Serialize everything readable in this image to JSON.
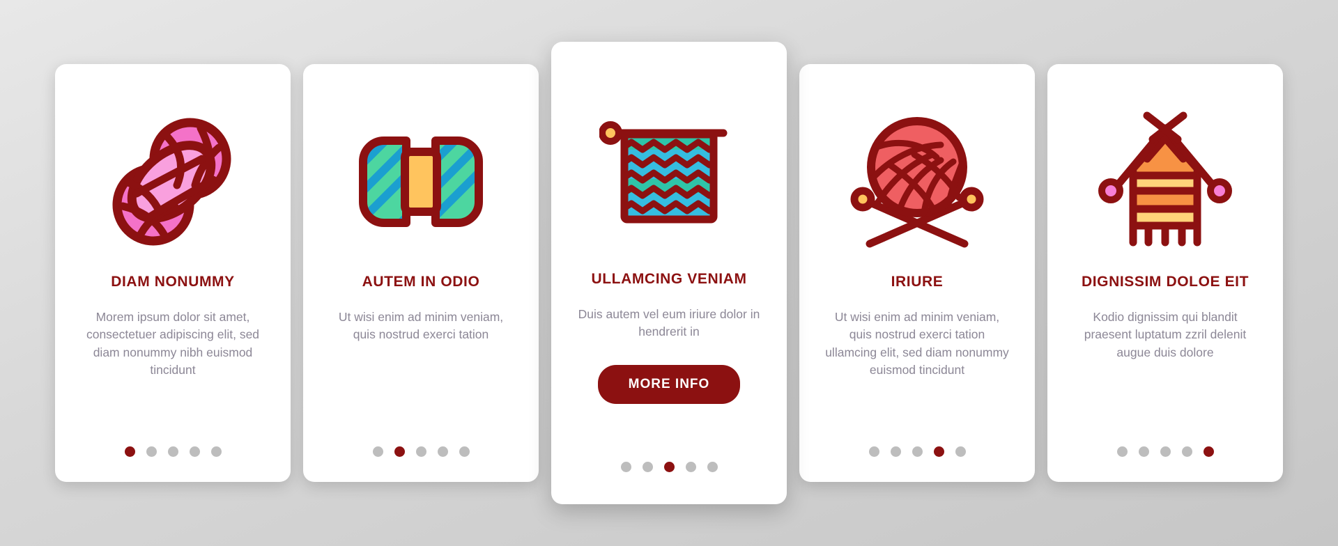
{
  "accent_color": "#8c1111",
  "dot_inactive_color": "#bdbdbd",
  "body_text_color": "#8c8796",
  "card_background": "#ffffff",
  "page_background": "#d4d4d4",
  "cards": [
    {
      "icon": "yarn-skeins-icon",
      "title": "DIAM NONUMMY",
      "body": "Morem ipsum dolor sit amet, consectetuer adipiscing elit, sed diam nonummy nibh euismod tincidunt",
      "featured": false,
      "dots_total": 5,
      "active_dot": 1
    },
    {
      "icon": "knitted-bow-tie-icon",
      "title": "AUTEM IN ODIO",
      "body": "Ut wisi enim ad minim veniam, quis nostrud exerci tation",
      "featured": false,
      "dots_total": 5,
      "active_dot": 2
    },
    {
      "icon": "knitted-towel-on-rod-icon",
      "title": "ULLAMCING VENIAM",
      "body": "Duis autem vel eum iriure dolor in hendrerit in",
      "button_label": "MORE INFO",
      "featured": true,
      "dots_total": 5,
      "active_dot": 3
    },
    {
      "icon": "yarn-ball-with-needles-icon",
      "title": "IRIURE",
      "body": "Ut wisi enim ad minim veniam, quis nostrud exerci tation ullamcing elit, sed diam nonummy euismod tincidunt",
      "featured": false,
      "dots_total": 5,
      "active_dot": 4
    },
    {
      "icon": "knitting-on-needles-icon",
      "title": "DIGNISSIM DOLOE EIT",
      "body": "Kodio dignissim qui blandit praesent luptatum zzril delenit augue duis dolore",
      "featured": false,
      "dots_total": 5,
      "active_dot": 5
    }
  ]
}
